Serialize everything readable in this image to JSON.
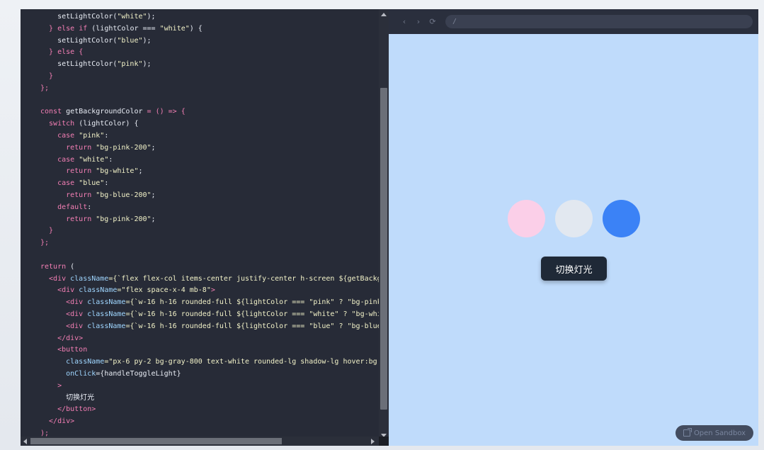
{
  "code_lines": [
    [
      {
        "t": "    setLightColor(",
        "c": "fn"
      },
      {
        "t": "\"white\"",
        "c": "str"
      },
      {
        "t": ");",
        "c": "fn"
      }
    ],
    [
      {
        "t": "  } ",
        "c": "kw"
      },
      {
        "t": "else if",
        "c": "kw"
      },
      {
        "t": " (lightColor === ",
        "c": "fn"
      },
      {
        "t": "\"white\"",
        "c": "str"
      },
      {
        "t": ") {",
        "c": "fn"
      }
    ],
    [
      {
        "t": "    setLightColor(",
        "c": "fn"
      },
      {
        "t": "\"blue\"",
        "c": "str"
      },
      {
        "t": ");",
        "c": "fn"
      }
    ],
    [
      {
        "t": "  } ",
        "c": "kw"
      },
      {
        "t": "else",
        "c": "kw"
      },
      {
        "t": " {",
        "c": "kw"
      }
    ],
    [
      {
        "t": "    setLightColor(",
        "c": "fn"
      },
      {
        "t": "\"pink\"",
        "c": "str"
      },
      {
        "t": ");",
        "c": "fn"
      }
    ],
    [
      {
        "t": "  }",
        "c": "kw"
      }
    ],
    [
      {
        "t": "};",
        "c": "kw"
      }
    ],
    [
      {
        "t": "",
        "c": "fn"
      }
    ],
    [
      {
        "t": "const",
        "c": "kw"
      },
      {
        "t": " getBackgroundColor ",
        "c": "fn"
      },
      {
        "t": "= () => {",
        "c": "kw"
      }
    ],
    [
      {
        "t": "  switch",
        "c": "kw"
      },
      {
        "t": " (lightColor) {",
        "c": "fn"
      }
    ],
    [
      {
        "t": "    case",
        "c": "kw"
      },
      {
        "t": " \"pink\"",
        "c": "str"
      },
      {
        "t": ":",
        "c": "fn"
      }
    ],
    [
      {
        "t": "      return",
        "c": "kw"
      },
      {
        "t": " \"bg-pink-200\"",
        "c": "str"
      },
      {
        "t": ";",
        "c": "fn"
      }
    ],
    [
      {
        "t": "    case",
        "c": "kw"
      },
      {
        "t": " \"white\"",
        "c": "str"
      },
      {
        "t": ":",
        "c": "fn"
      }
    ],
    [
      {
        "t": "      return",
        "c": "kw"
      },
      {
        "t": " \"bg-white\"",
        "c": "str"
      },
      {
        "t": ";",
        "c": "fn"
      }
    ],
    [
      {
        "t": "    case",
        "c": "kw"
      },
      {
        "t": " \"blue\"",
        "c": "str"
      },
      {
        "t": ":",
        "c": "fn"
      }
    ],
    [
      {
        "t": "      return",
        "c": "kw"
      },
      {
        "t": " \"bg-blue-200\"",
        "c": "str"
      },
      {
        "t": ";",
        "c": "fn"
      }
    ],
    [
      {
        "t": "    default",
        "c": "kw"
      },
      {
        "t": ":",
        "c": "fn"
      }
    ],
    [
      {
        "t": "      return",
        "c": "kw"
      },
      {
        "t": " \"bg-pink-200\"",
        "c": "str"
      },
      {
        "t": ";",
        "c": "fn"
      }
    ],
    [
      {
        "t": "  }",
        "c": "kw"
      }
    ],
    [
      {
        "t": "};",
        "c": "kw"
      }
    ],
    [
      {
        "t": "",
        "c": "fn"
      }
    ],
    [
      {
        "t": "return",
        "c": "kw"
      },
      {
        "t": " (",
        "c": "fn"
      }
    ],
    [
      {
        "t": "  <div",
        "c": "tag"
      },
      {
        "t": " className",
        "c": "attr"
      },
      {
        "t": "={`flex flex-col items-center justify-center h-screen ${getBackg",
        "c": "str"
      }
    ],
    [
      {
        "t": "    <div",
        "c": "tag"
      },
      {
        "t": " className",
        "c": "attr"
      },
      {
        "t": "=\"flex space-x-4 mb-8\"",
        "c": "str"
      },
      {
        "t": ">",
        "c": "tag"
      }
    ],
    [
      {
        "t": "      <div",
        "c": "tag"
      },
      {
        "t": " className",
        "c": "attr"
      },
      {
        "t": "={`w-16 h-16 rounded-full ${lightColor === \"pink\" ? \"bg-pink",
        "c": "str"
      }
    ],
    [
      {
        "t": "      <div",
        "c": "tag"
      },
      {
        "t": " className",
        "c": "attr"
      },
      {
        "t": "={`w-16 h-16 rounded-full ${lightColor === \"white\" ? \"bg-whi",
        "c": "str"
      }
    ],
    [
      {
        "t": "      <div",
        "c": "tag"
      },
      {
        "t": " className",
        "c": "attr"
      },
      {
        "t": "={`w-16 h-16 rounded-full ${lightColor === \"blue\" ? \"bg-blue",
        "c": "str"
      }
    ],
    [
      {
        "t": "    </div>",
        "c": "tag"
      }
    ],
    [
      {
        "t": "    <button",
        "c": "tag"
      }
    ],
    [
      {
        "t": "      className",
        "c": "attr"
      },
      {
        "t": "=\"px-6 py-2 bg-gray-800 text-white rounded-lg shadow-lg hover:bg",
        "c": "str"
      }
    ],
    [
      {
        "t": "      onClick",
        "c": "attr"
      },
      {
        "t": "={handleToggleLight}",
        "c": "fn"
      }
    ],
    [
      {
        "t": "    >",
        "c": "tag"
      }
    ],
    [
      {
        "t": "      切换灯光",
        "c": "fn"
      }
    ],
    [
      {
        "t": "    </button>",
        "c": "tag"
      }
    ],
    [
      {
        "t": "  </div>",
        "c": "tag"
      }
    ],
    [
      {
        "t": ");",
        "c": "kw"
      }
    ]
  ],
  "browser": {
    "back": "‹",
    "forward": "›",
    "refresh": "⟳",
    "url": "/"
  },
  "preview": {
    "lights": [
      {
        "color": "#fbcfe8"
      },
      {
        "color": "#e2e8f0"
      },
      {
        "color": "#3b82f6"
      }
    ],
    "toggle_label": "切换灯光",
    "sandbox_label": "Open Sandbox"
  }
}
